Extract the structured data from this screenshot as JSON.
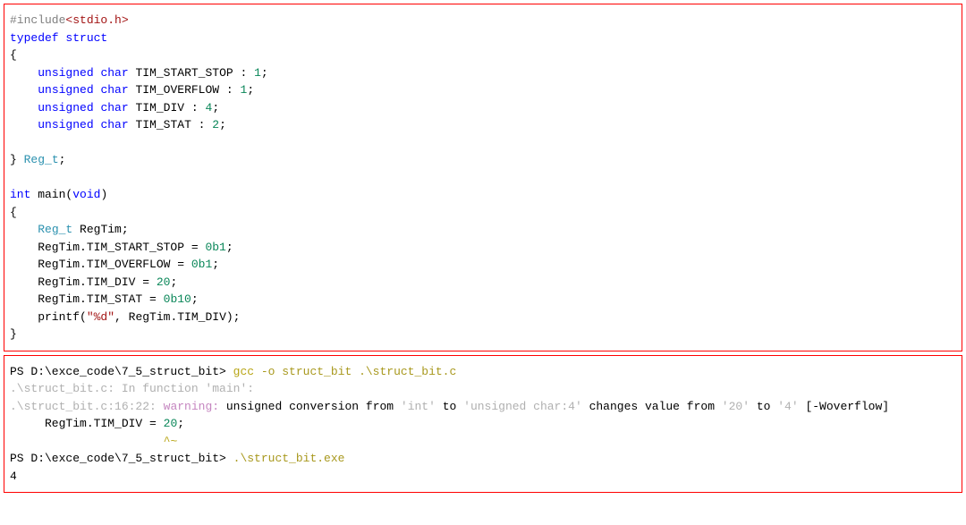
{
  "code": {
    "lines": [
      [
        [
          "tok-directive",
          "#include"
        ],
        [
          "tok-include-angle",
          "<stdio.h>"
        ]
      ],
      [
        [
          "tok-keyword",
          "typedef"
        ],
        [
          "tok-text",
          " "
        ],
        [
          "tok-keyword",
          "struct"
        ]
      ],
      [
        [
          "tok-text",
          "{"
        ]
      ],
      [
        [
          "tok-text",
          "    "
        ],
        [
          "tok-keyword",
          "unsigned"
        ],
        [
          "tok-text",
          " "
        ],
        [
          "tok-keyword",
          "char"
        ],
        [
          "tok-text",
          " TIM_START_STOP : "
        ],
        [
          "tok-number",
          "1"
        ],
        [
          "tok-text",
          ";"
        ]
      ],
      [
        [
          "tok-text",
          "    "
        ],
        [
          "tok-keyword",
          "unsigned"
        ],
        [
          "tok-text",
          " "
        ],
        [
          "tok-keyword",
          "char"
        ],
        [
          "tok-text",
          " TIM_OVERFLOW : "
        ],
        [
          "tok-number",
          "1"
        ],
        [
          "tok-text",
          ";"
        ]
      ],
      [
        [
          "tok-text",
          "    "
        ],
        [
          "tok-keyword",
          "unsigned"
        ],
        [
          "tok-text",
          " "
        ],
        [
          "tok-keyword",
          "char"
        ],
        [
          "tok-text",
          " TIM_DIV : "
        ],
        [
          "tok-number",
          "4"
        ],
        [
          "tok-text",
          ";"
        ]
      ],
      [
        [
          "tok-text",
          "    "
        ],
        [
          "tok-keyword",
          "unsigned"
        ],
        [
          "tok-text",
          " "
        ],
        [
          "tok-keyword",
          "char"
        ],
        [
          "tok-text",
          " TIM_STAT : "
        ],
        [
          "tok-number",
          "2"
        ],
        [
          "tok-text",
          ";"
        ]
      ],
      [
        [
          "tok-text",
          ""
        ]
      ],
      [
        [
          "tok-text",
          "} "
        ],
        [
          "tok-type",
          "Reg_t"
        ],
        [
          "tok-text",
          ";"
        ]
      ],
      [
        [
          "tok-text",
          ""
        ]
      ],
      [
        [
          "tok-keyword",
          "int"
        ],
        [
          "tok-text",
          " main("
        ],
        [
          "tok-keyword",
          "void"
        ],
        [
          "tok-text",
          ")"
        ]
      ],
      [
        [
          "tok-text",
          "{"
        ]
      ],
      [
        [
          "tok-text",
          "    "
        ],
        [
          "tok-type",
          "Reg_t"
        ],
        [
          "tok-text",
          " RegTim;"
        ]
      ],
      [
        [
          "tok-text",
          "    RegTim.TIM_START_STOP = "
        ],
        [
          "tok-number",
          "0b1"
        ],
        [
          "tok-text",
          ";"
        ]
      ],
      [
        [
          "tok-text",
          "    RegTim.TIM_OVERFLOW = "
        ],
        [
          "tok-number",
          "0b1"
        ],
        [
          "tok-text",
          ";"
        ]
      ],
      [
        [
          "tok-text",
          "    RegTim.TIM_DIV = "
        ],
        [
          "tok-number",
          "20"
        ],
        [
          "tok-text",
          ";"
        ]
      ],
      [
        [
          "tok-text",
          "    RegTim.TIM_STAT = "
        ],
        [
          "tok-number",
          "0b10"
        ],
        [
          "tok-text",
          ";"
        ]
      ],
      [
        [
          "tok-text",
          "    printf("
        ],
        [
          "tok-string",
          "\"%d\""
        ],
        [
          "tok-text",
          ", RegTim.TIM_DIV);"
        ]
      ],
      [
        [
          "tok-text",
          "}"
        ]
      ]
    ]
  },
  "terminal": {
    "lines": [
      [
        [
          "tok-text",
          "PS D:\\exce_code\\7_5_struct_bit> "
        ],
        [
          "tok-cmd",
          "gcc"
        ],
        [
          "tok-cmd2",
          " -o struct_bit .\\struct_bit.c"
        ]
      ],
      [
        [
          "tok-note",
          ".\\struct_bit.c: In function 'main':"
        ]
      ],
      [
        [
          "tok-note",
          ".\\struct_bit.c:16:22: "
        ],
        [
          "tok-warn",
          "warning:"
        ],
        [
          "tok-text",
          " unsigned conversion from "
        ],
        [
          "tok-type-faint",
          "'int'"
        ],
        [
          "tok-text",
          " to "
        ],
        [
          "tok-type-faint",
          "'unsigned char:4'"
        ],
        [
          "tok-text",
          " changes value from "
        ],
        [
          "tok-type-faint",
          "'20'"
        ],
        [
          "tok-text",
          " to "
        ],
        [
          "tok-type-faint",
          "'4'"
        ],
        [
          "tok-text",
          " [-Woverflow]"
        ]
      ],
      [
        [
          "tok-text",
          "     RegTim.TIM_DIV = "
        ],
        [
          "tok-number",
          "20"
        ],
        [
          "tok-text",
          ";"
        ]
      ],
      [
        [
          "tok-text",
          "                      "
        ],
        [
          "tok-caret",
          "^~"
        ]
      ],
      [
        [
          "tok-text",
          "PS D:\\exce_code\\7_5_struct_bit> "
        ],
        [
          "tok-cmd2",
          ".\\struct_bit.exe"
        ]
      ],
      [
        [
          "tok-text",
          "4"
        ]
      ]
    ]
  }
}
